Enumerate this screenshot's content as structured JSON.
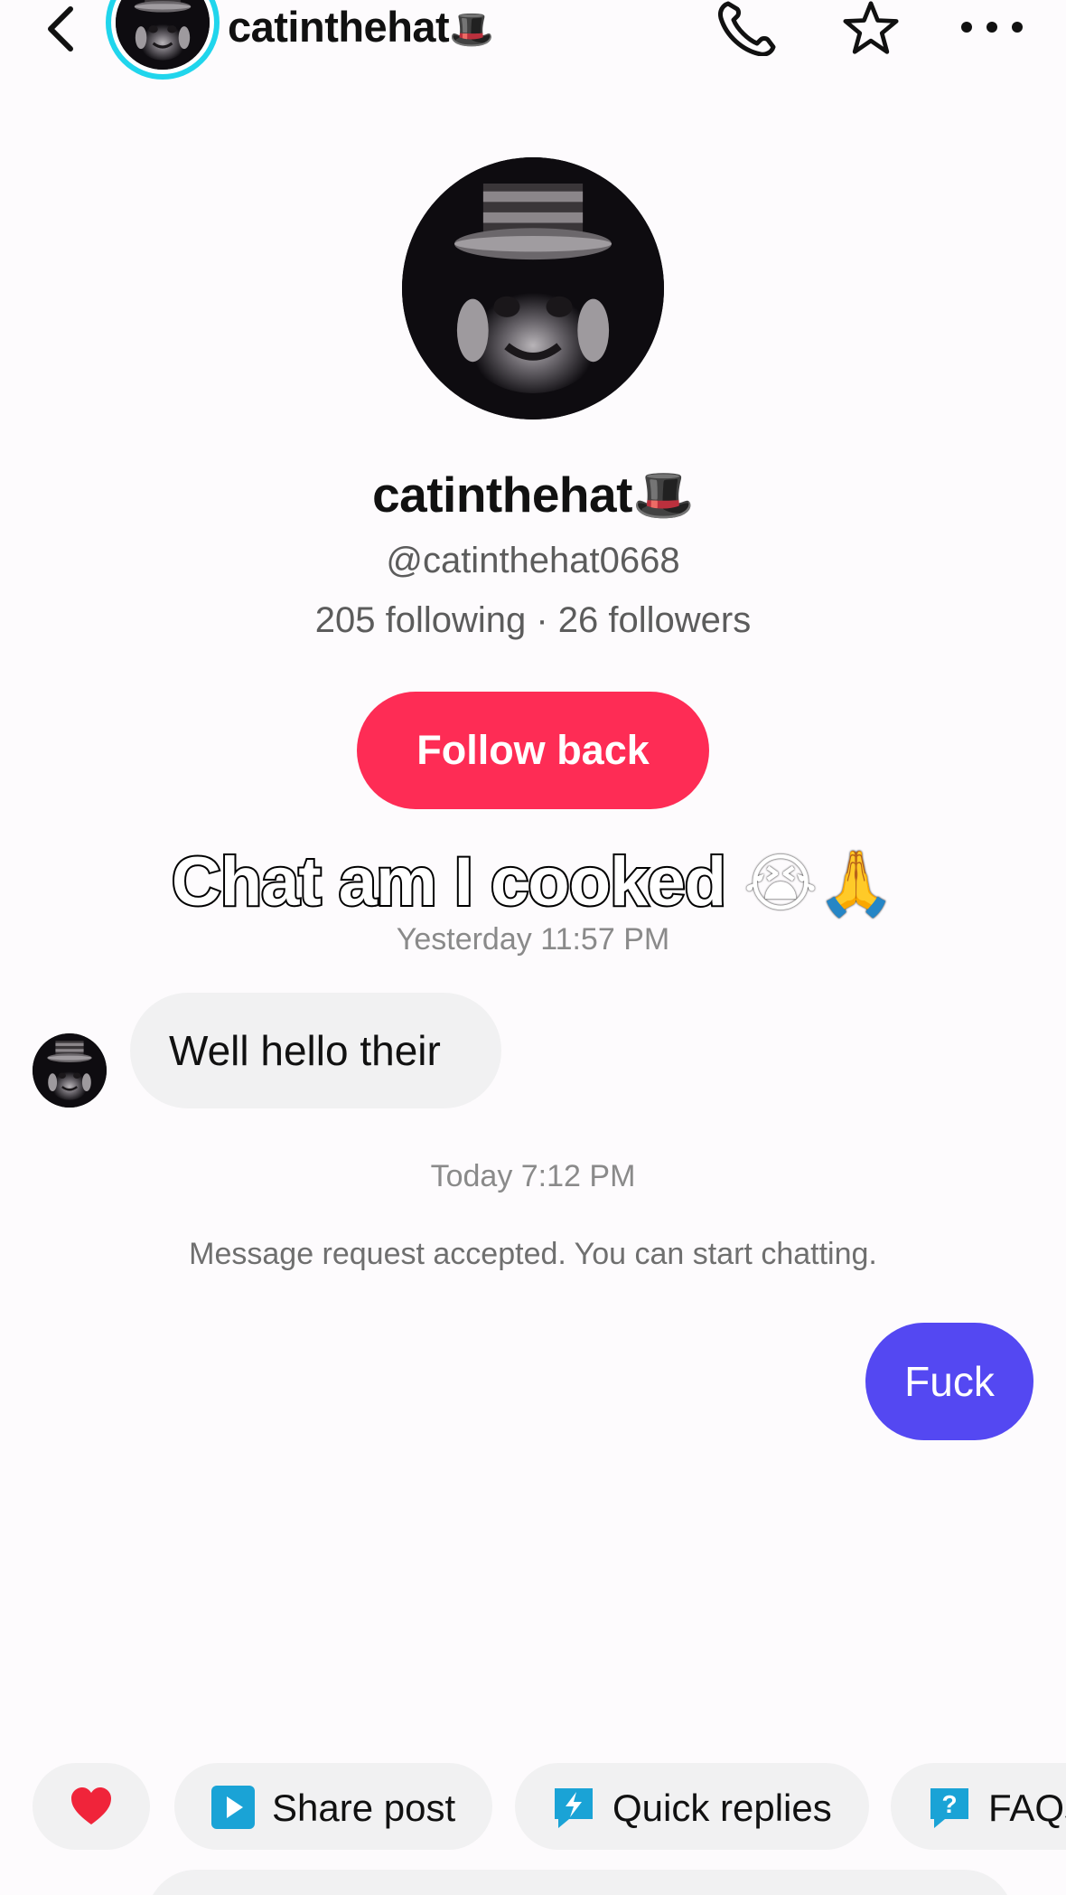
{
  "header": {
    "username": "catinthehat",
    "username_emoji": "🎩"
  },
  "profile": {
    "display_name": "catinthehat",
    "display_name_emoji": "🎩",
    "handle": "@catinthehat0668",
    "stats": "205 following · 26 followers",
    "follow_back_label": "Follow back"
  },
  "overlay_caption": {
    "text": "Chat am I cooked",
    "emojis": "😭🙏"
  },
  "messages": {
    "timestamp_1": "Yesterday 11:57 PM",
    "incoming_text": "Well hello their",
    "timestamp_2": "Today 7:12 PM",
    "system_text": "Message request accepted. You can start chatting.",
    "outgoing_text": "Fuck"
  },
  "quick_actions": {
    "share_post": "Share post",
    "quick_replies": "Quick replies",
    "faqs": "FAQs"
  },
  "colors": {
    "follow_button": "#fe2c55",
    "outgoing_bubble": "#5448f2",
    "incoming_bubble": "#f1f1f2",
    "avatar_ring": "#20d5ec",
    "chip_icon": "#1aa3d6",
    "heart": "#f0243a"
  },
  "icons": [
    "back-chevron-icon",
    "phone-icon",
    "star-icon",
    "more-icon",
    "heart-icon",
    "play-icon",
    "lightning-icon",
    "question-icon"
  ]
}
